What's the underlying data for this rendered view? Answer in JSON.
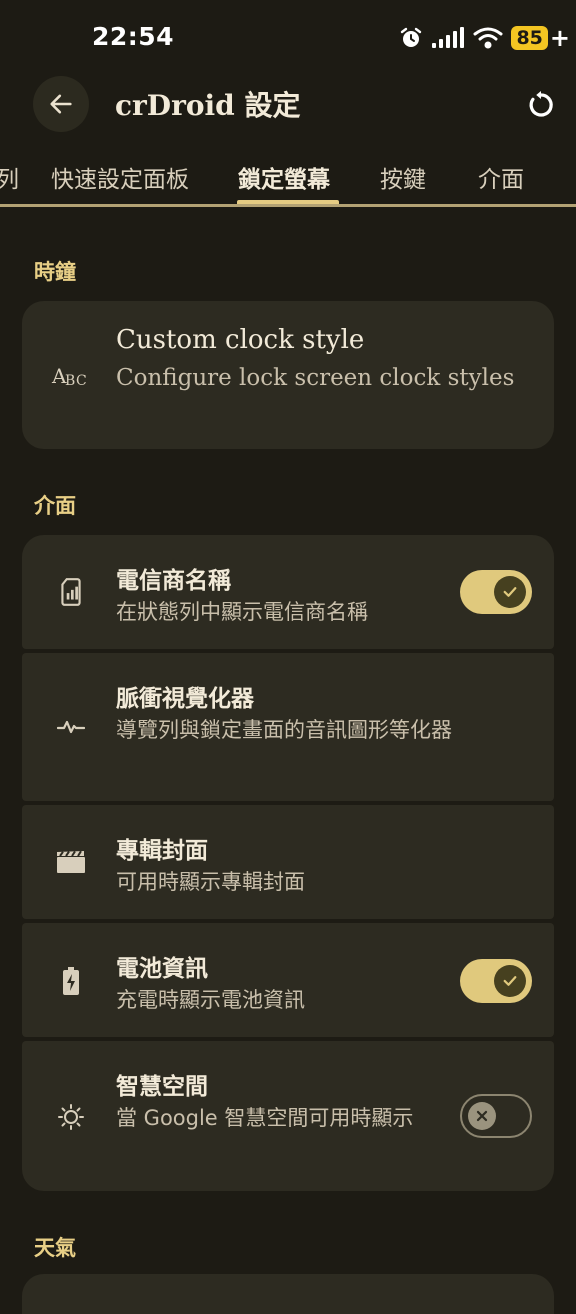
{
  "status_bar": {
    "time": "22:54",
    "battery": "85",
    "battery_charging_symbol": "+"
  },
  "app_bar": {
    "title": "crDroid 設定"
  },
  "tabs": [
    {
      "label": "列",
      "active": false
    },
    {
      "label": "快速設定面板",
      "active": false
    },
    {
      "label": "鎖定螢幕",
      "active": true
    },
    {
      "label": "按鍵",
      "active": false
    },
    {
      "label": "介面",
      "active": false
    }
  ],
  "sections": {
    "clock": {
      "title": "時鐘",
      "items": [
        {
          "title": "Custom clock style",
          "summary": "Configure lock screen clock styles",
          "icon": "clock-style-icon"
        }
      ]
    },
    "interface": {
      "title": "介面",
      "items": [
        {
          "title": "電信商名稱",
          "summary": "在狀態列中顯示電信商名稱",
          "icon": "sim-card-icon",
          "toggle": true
        },
        {
          "title": "脈衝視覺化器",
          "summary": "導覽列與鎖定畫面的音訊圖形等化器",
          "icon": "pulse-icon"
        },
        {
          "title": "專輯封面",
          "summary": "可用時顯示專輯封面",
          "icon": "movie-icon"
        },
        {
          "title": "電池資訊",
          "summary": "充電時顯示電池資訊",
          "icon": "battery-charging-icon",
          "toggle": true
        },
        {
          "title": "智慧空間",
          "summary": "當 Google 智慧空間可用時顯示",
          "icon": "brightness-icon",
          "toggle": false
        }
      ]
    },
    "weather": {
      "title": "天氣"
    }
  },
  "colors": {
    "background": "#1d1b14",
    "card": "#2d2b21",
    "accent": "#e0c97d",
    "battery": "#f3c522"
  }
}
